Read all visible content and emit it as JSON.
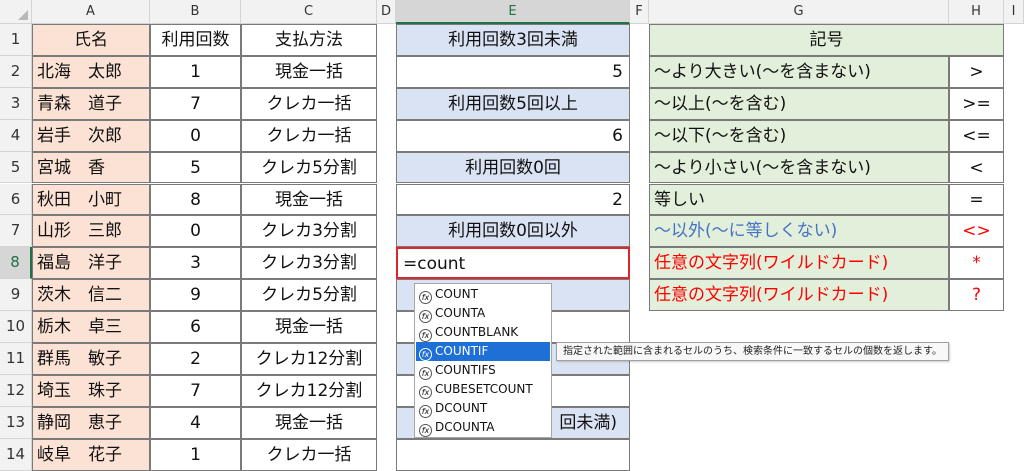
{
  "columns": [
    "A",
    "B",
    "C",
    "D",
    "E",
    "F",
    "G",
    "H",
    "I"
  ],
  "rows": [
    "1",
    "2",
    "3",
    "4",
    "5",
    "6",
    "7",
    "8",
    "9",
    "10",
    "11",
    "12",
    "13",
    "14"
  ],
  "table": {
    "headers": [
      "氏名",
      "利用回数",
      "支払方法"
    ],
    "rows": [
      [
        "北海　太郎",
        "1",
        "現金一括"
      ],
      [
        "青森　道子",
        "7",
        "クレカ一括"
      ],
      [
        "岩手　次郎",
        "0",
        "クレカ一括"
      ],
      [
        "宮城　香",
        "5",
        "クレカ5分割"
      ],
      [
        "秋田　小町",
        "8",
        "現金一括"
      ],
      [
        "山形　三郎",
        "0",
        "クレカ3分割"
      ],
      [
        "福島　洋子",
        "3",
        "クレカ3分割"
      ],
      [
        "茨木　信二",
        "9",
        "クレカ5分割"
      ],
      [
        "栃木　卓三",
        "6",
        "現金一括"
      ],
      [
        "群馬　敏子",
        "2",
        "クレカ12分割"
      ],
      [
        "埼玉　珠子",
        "7",
        "クレカ12分割"
      ],
      [
        "静岡　恵子",
        "4",
        "現金一括"
      ],
      [
        "岐阜　花子",
        "1",
        "クレカ一括"
      ]
    ]
  },
  "summary": {
    "label1": "利用回数3回未満",
    "value1": "5",
    "label2": "利用回数5回以上",
    "value2": "6",
    "label3": "利用回数0回",
    "value3": "2",
    "label4": "利用回数0回以外",
    "active_input": "=count",
    "partial_label": "回未満)"
  },
  "symbols": {
    "header": "記号",
    "rows": [
      [
        "～より大きい(～を含まない)",
        ">"
      ],
      [
        "～以上(～を含む)",
        ">="
      ],
      [
        "～以下(～を含む)",
        "<="
      ],
      [
        "～より小さい(～を含まない)",
        "<"
      ],
      [
        "等しい",
        "="
      ],
      [
        "～以外(～に等しくない)",
        "<>"
      ],
      [
        "任意の文字列(ワイルドカード)",
        "*"
      ],
      [
        "任意の文字列(ワイルドカード)",
        "?"
      ]
    ]
  },
  "autocomplete": {
    "items": [
      "COUNT",
      "COUNTA",
      "COUNTBLANK",
      "COUNTIF",
      "COUNTIFS",
      "CUBESETCOUNT",
      "DCOUNT",
      "DCOUNTA"
    ],
    "selected_index": 3,
    "tooltip": "指定された範囲に含まれるセルのうち、検索条件に一致するセルの個数を返します。",
    "icon_glyph": "fx"
  },
  "colors": {
    "pink": "#fbe2d5",
    "blue": "#dae3f3",
    "green": "#e2efda",
    "red": "#ff0000",
    "link_blue": "#4472c4",
    "highlight": "#1e6fd6"
  }
}
